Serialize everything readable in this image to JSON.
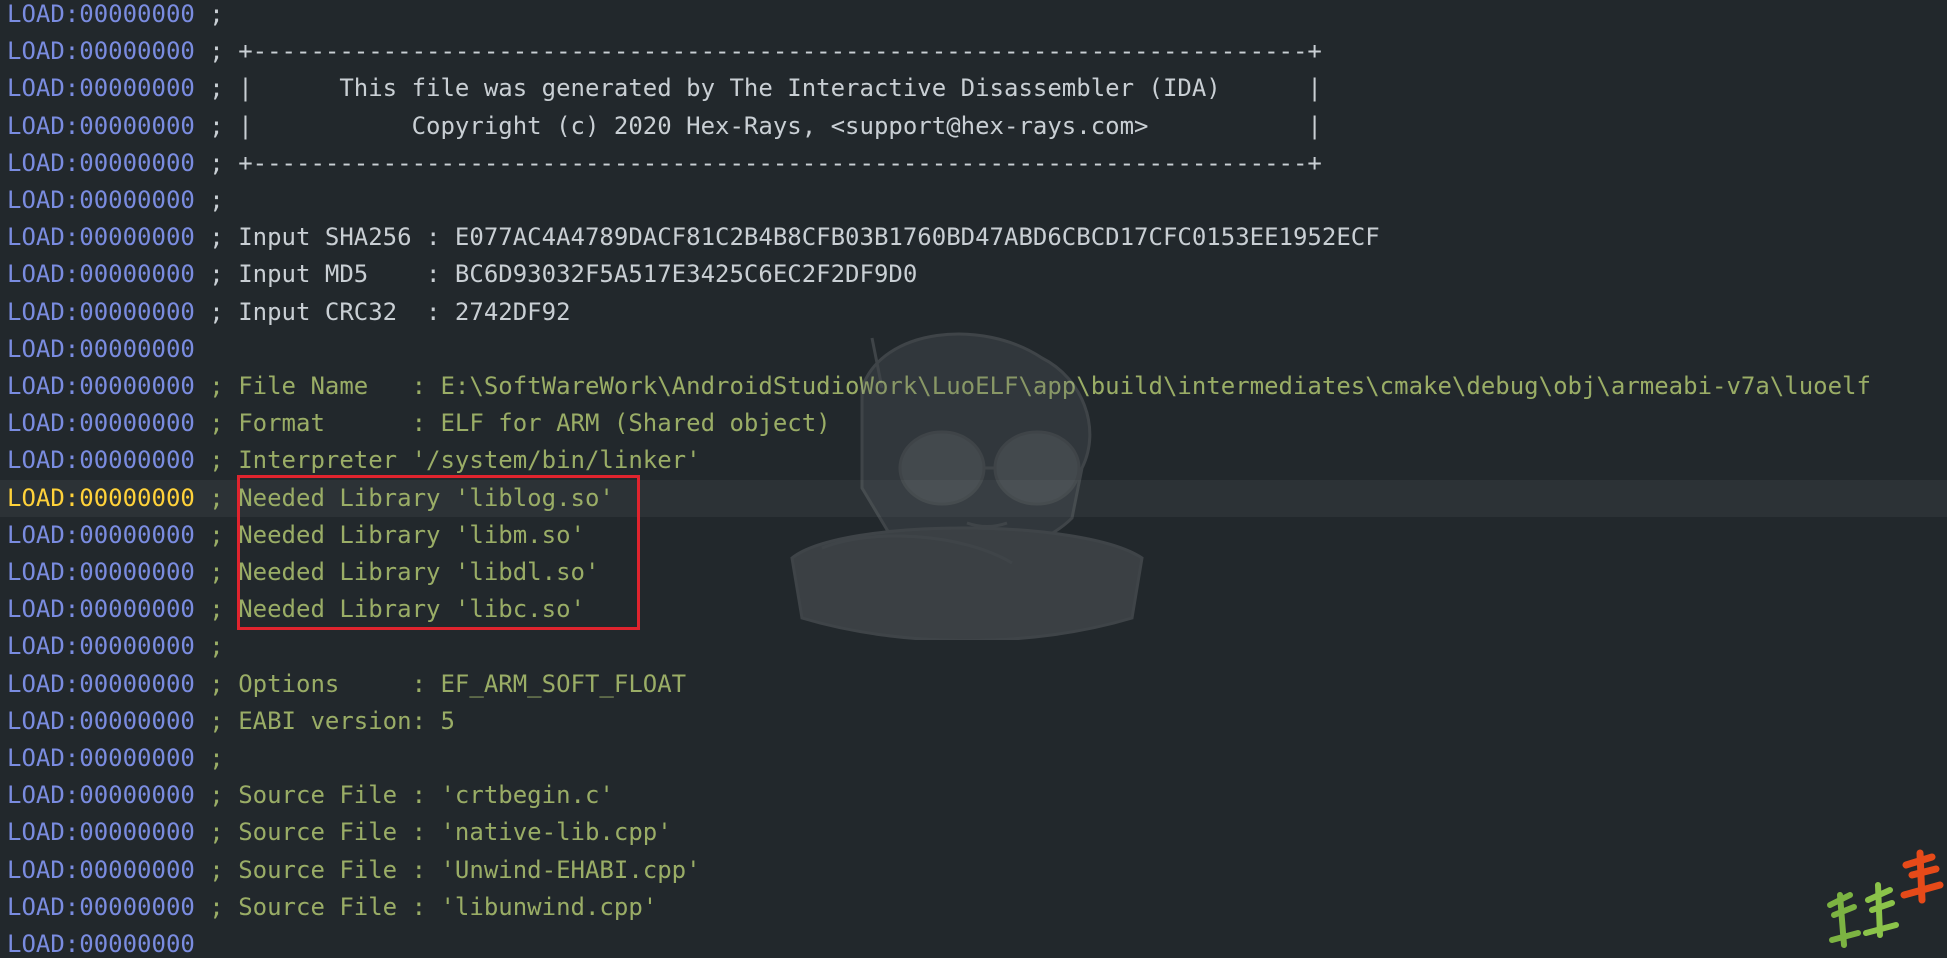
{
  "colors": {
    "background": "#22282c",
    "current_line_background": "#2c3236",
    "address": "#7a8ce0",
    "current_address": "#ffd23a",
    "comment_light": "#c9cfd4",
    "comment_green": "#9aad66",
    "highlight_box": "#e0242e"
  },
  "listing": {
    "lines": [
      {
        "address": "LOAD:00000000",
        "text": " ;",
        "style": "light"
      },
      {
        "address": "LOAD:00000000",
        "text": " ; +-------------------------------------------------------------------------+",
        "style": "light"
      },
      {
        "address": "LOAD:00000000",
        "text": " ; |      This file was generated by The Interactive Disassembler (IDA)      |",
        "style": "light"
      },
      {
        "address": "LOAD:00000000",
        "text": " ; |           Copyright (c) 2020 Hex-Rays, <support@hex-rays.com>           |",
        "style": "light"
      },
      {
        "address": "LOAD:00000000",
        "text": " ; +-------------------------------------------------------------------------+",
        "style": "light"
      },
      {
        "address": "LOAD:00000000",
        "text": " ;",
        "style": "light"
      },
      {
        "address": "LOAD:00000000",
        "text": " ; Input SHA256 : E077AC4A4789DACF81C2B4B8CFB03B1760BD47ABD6CBCD17CFC0153EE1952ECF",
        "style": "light"
      },
      {
        "address": "LOAD:00000000",
        "text": " ; Input MD5    : BC6D93032F5A517E3425C6EC2F2DF9D0",
        "style": "light"
      },
      {
        "address": "LOAD:00000000",
        "text": " ; Input CRC32  : 2742DF92",
        "style": "light"
      },
      {
        "address": "LOAD:00000000",
        "text": "",
        "style": "light"
      },
      {
        "address": "LOAD:00000000",
        "text": " ; File Name   : E:\\SoftWareWork\\AndroidStudioWork\\LuoELF\\app\\build\\intermediates\\cmake\\debug\\obj\\armeabi-v7a\\luoelf",
        "style": "green"
      },
      {
        "address": "LOAD:00000000",
        "text": " ; Format      : ELF for ARM (Shared object)",
        "style": "green"
      },
      {
        "address": "LOAD:00000000",
        "text": " ; Interpreter '/system/bin/linker'",
        "style": "green"
      },
      {
        "address": "LOAD:00000000",
        "text": " ; Needed Library 'liblog.so'",
        "style": "green",
        "current": true
      },
      {
        "address": "LOAD:00000000",
        "text": " ; Needed Library 'libm.so'",
        "style": "green"
      },
      {
        "address": "LOAD:00000000",
        "text": " ; Needed Library 'libdl.so'",
        "style": "green"
      },
      {
        "address": "LOAD:00000000",
        "text": " ; Needed Library 'libc.so'",
        "style": "green"
      },
      {
        "address": "LOAD:00000000",
        "text": " ;",
        "style": "green"
      },
      {
        "address": "LOAD:00000000",
        "text": " ; Options     : EF_ARM_SOFT_FLOAT",
        "style": "green"
      },
      {
        "address": "LOAD:00000000",
        "text": " ; EABI version: 5",
        "style": "green"
      },
      {
        "address": "LOAD:00000000",
        "text": " ;",
        "style": "green"
      },
      {
        "address": "LOAD:00000000",
        "text": " ; Source File : 'crtbegin.c'",
        "style": "green"
      },
      {
        "address": "LOAD:00000000",
        "text": " ; Source File : 'native-lib.cpp'",
        "style": "green"
      },
      {
        "address": "LOAD:00000000",
        "text": " ; Source File : 'Unwind-EHABI.cpp'",
        "style": "green"
      },
      {
        "address": "LOAD:00000000",
        "text": " ; Source File : 'libunwind.cpp'",
        "style": "green"
      },
      {
        "address": "LOAD:00000000",
        "text": "",
        "style": "green"
      }
    ]
  },
  "icons": {
    "mascot": "anime-character-watermark-icon",
    "corner": "brush-calligraphy-watermark-icon"
  }
}
